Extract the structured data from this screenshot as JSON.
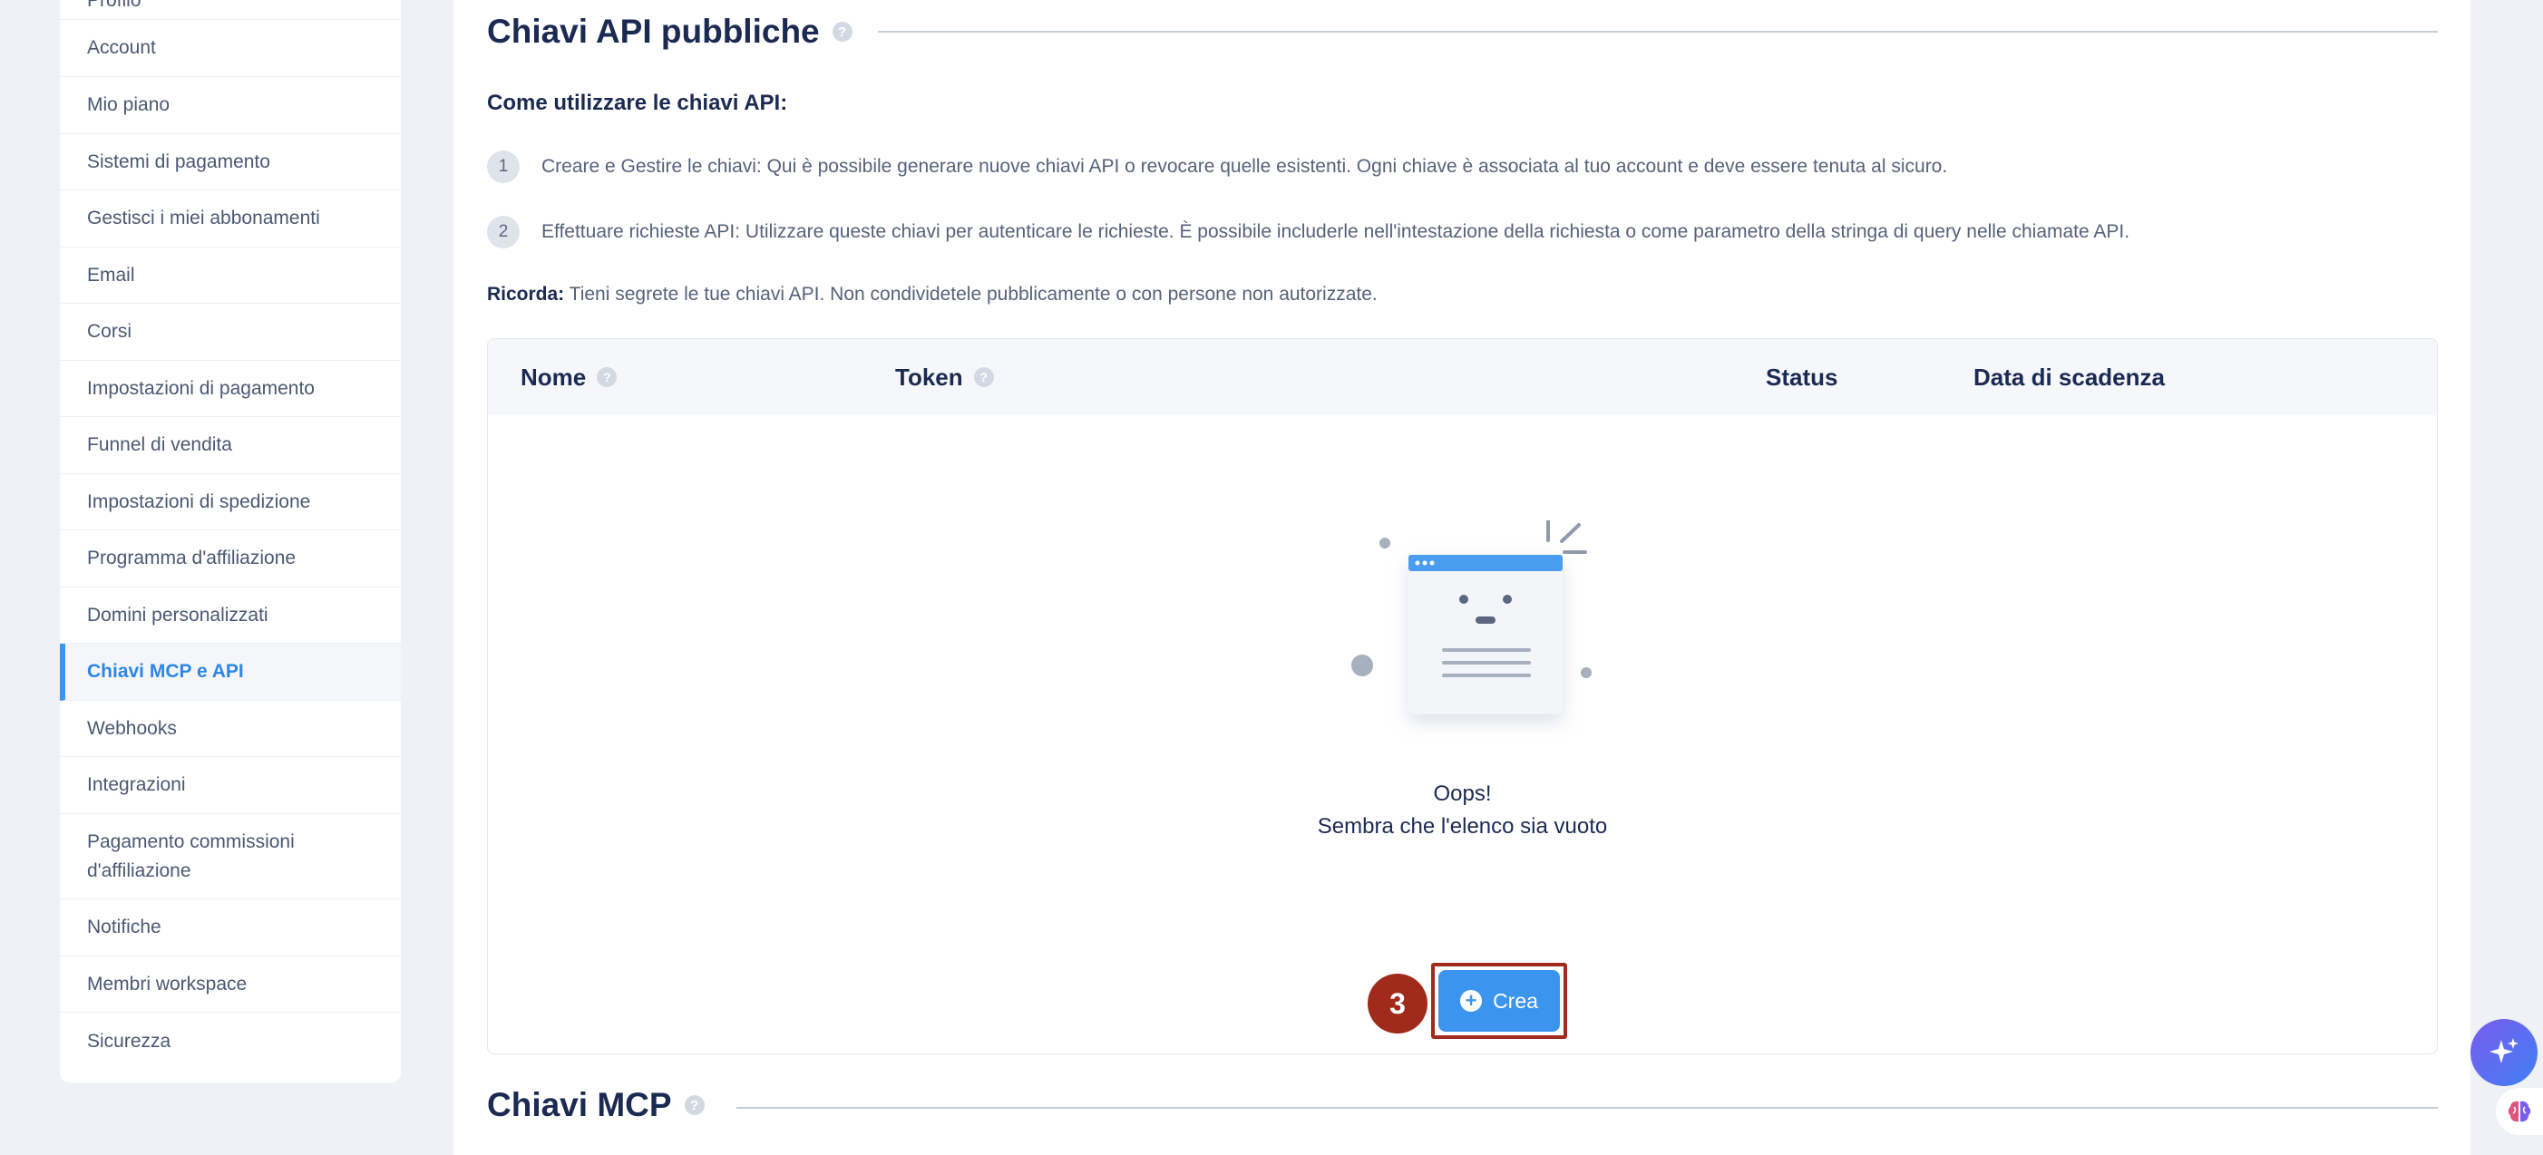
{
  "sidebar": {
    "items": [
      {
        "label": "Profilo"
      },
      {
        "label": "Account"
      },
      {
        "label": "Mio piano"
      },
      {
        "label": "Sistemi di pagamento"
      },
      {
        "label": "Gestisci i miei abbonamenti"
      },
      {
        "label": "Email"
      },
      {
        "label": "Corsi"
      },
      {
        "label": "Impostazioni di pagamento"
      },
      {
        "label": "Funnel di vendita"
      },
      {
        "label": "Impostazioni di spedizione"
      },
      {
        "label": "Programma d'affiliazione"
      },
      {
        "label": "Domini personalizzati"
      },
      {
        "label": "Chiavi MCP e API",
        "active": true
      },
      {
        "label": "Webhooks"
      },
      {
        "label": "Integrazioni"
      },
      {
        "label": "Pagamento commissioni d'affiliazione"
      },
      {
        "label": "Notifiche"
      },
      {
        "label": "Membri workspace"
      },
      {
        "label": "Sicurezza"
      }
    ]
  },
  "api_section": {
    "title": "Chiavi API pubbliche",
    "howto_title": "Come utilizzare le chiavi API:",
    "steps": [
      {
        "num": "1",
        "text": "Creare e Gestire le chiavi: Qui è possibile generare nuove chiavi API o revocare quelle esistenti. Ogni chiave è associata al tuo account e deve essere tenuta al sicuro."
      },
      {
        "num": "2",
        "text": "Effettuare richieste API: Utilizzare queste chiavi per autenticare le richieste. È possibile includerle nell'intestazione della richiesta o come parametro della stringa di query nelle chiamate API."
      }
    ],
    "remember_label": "Ricorda:",
    "remember_text": " Tieni segrete le tue chiavi API. Non condividetele pubblicamente o con persone non autorizzate."
  },
  "table": {
    "columns": {
      "name": "Nome",
      "token": "Token",
      "status": "Status",
      "expiry": "Data di scadenza"
    },
    "empty_title": "Oops!",
    "empty_subtitle": "Sembra che l'elenco sia vuoto",
    "create_label": "Crea",
    "step_badge": "3"
  },
  "mcp_section": {
    "title": "Chiavi MCP"
  },
  "colors": {
    "accent": "#3b95ef",
    "highlight": "#a02a1b",
    "title": "#1b2a52"
  },
  "icons": {
    "help": "question-circle-icon",
    "create": "plus-circle-icon",
    "ai_assistant": "sparkle-icon",
    "brain": "brain-icon"
  }
}
